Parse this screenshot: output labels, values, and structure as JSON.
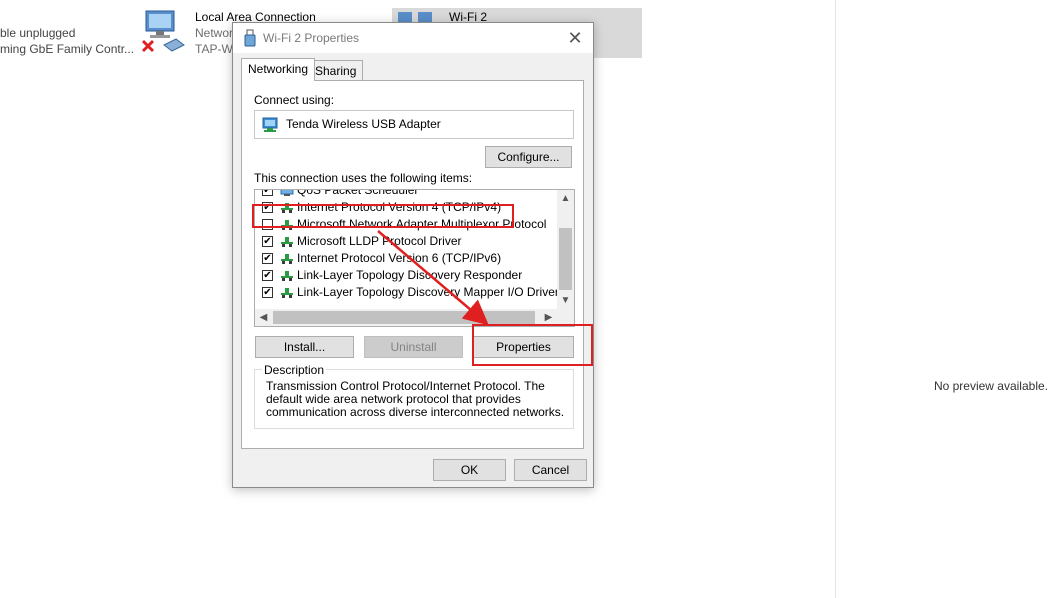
{
  "background": {
    "connections": [
      {
        "name": "",
        "status": "ble unplugged",
        "device": "ming GbE Family Contr..."
      },
      {
        "name": "Local Area Connection",
        "status": "Networ",
        "device": "TAP-Wi"
      },
      {
        "name": "Wi-Fi 2",
        "status": "",
        "device": ""
      }
    ],
    "preview_text": "No preview available."
  },
  "dialog": {
    "title": "Wi-Fi 2 Properties",
    "tabs": [
      {
        "label": "Networking",
        "active": true
      },
      {
        "label": "Sharing",
        "active": false
      }
    ],
    "connect_using_label": "Connect using:",
    "adapter_name": "Tenda Wireless USB Adapter",
    "configure_label": "Configure...",
    "items_label": "This connection uses the following items:",
    "items": [
      {
        "label": "QoS Packet Scheduler",
        "checked": true,
        "icon": "network-service-icon"
      },
      {
        "label": "Internet Protocol Version 4 (TCP/IPv4)",
        "checked": true,
        "icon": "protocol-icon"
      },
      {
        "label": "Microsoft Network Adapter Multiplexor Protocol",
        "checked": false,
        "icon": "protocol-icon"
      },
      {
        "label": "Microsoft LLDP Protocol Driver",
        "checked": true,
        "icon": "protocol-icon"
      },
      {
        "label": "Internet Protocol Version 6 (TCP/IPv6)",
        "checked": true,
        "icon": "protocol-icon"
      },
      {
        "label": "Link-Layer Topology Discovery Responder",
        "checked": true,
        "icon": "protocol-icon"
      },
      {
        "label": "Link-Layer Topology Discovery Mapper I/O Driver",
        "checked": true,
        "icon": "protocol-icon"
      }
    ],
    "install_label": "Install...",
    "uninstall_label": "Uninstall",
    "properties_label": "Properties",
    "description_legend": "Description",
    "description_text": "Transmission Control Protocol/Internet Protocol. The default wide area network protocol that provides communication across diverse interconnected networks.",
    "ok_label": "OK",
    "cancel_label": "Cancel",
    "checkmark": "✔",
    "close_glyph": "✕"
  },
  "colors": {
    "annotation": "#e02020",
    "dialog_bg": "#f0f0f0",
    "selection": "#d9d9d9"
  }
}
